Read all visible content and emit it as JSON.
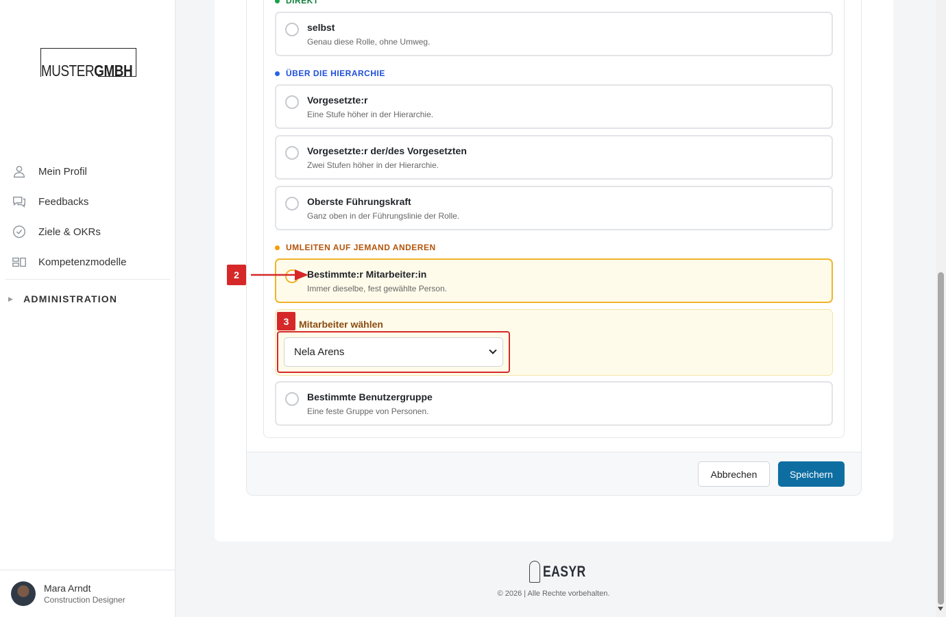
{
  "brand": {
    "logo_light": "MUSTER",
    "logo_bold": "GMBH"
  },
  "sidebar": {
    "items": [
      {
        "label": "Mein Profil",
        "icon": "user-icon"
      },
      {
        "label": "Feedbacks",
        "icon": "chat-icon"
      },
      {
        "label": "Ziele & OKRs",
        "icon": "check-circle-icon"
      },
      {
        "label": "Kompetenzmodelle",
        "icon": "grid-icon"
      }
    ],
    "admin_label": "ADMINISTRATION",
    "user": {
      "name": "Mara Arndt",
      "role": "Construction Designer"
    }
  },
  "form": {
    "sections": {
      "direct": {
        "label": "DIREKT",
        "color": "#16a34a"
      },
      "hierarchy": {
        "label": "ÜBER DIE HIERARCHIE",
        "color": "#2563eb"
      },
      "redirect": {
        "label": "UMLEITEN AUF JEMAND ANDEREN",
        "color": "#f59e0b"
      }
    },
    "options": [
      {
        "title": "selbst",
        "desc": "Genau diese Rolle, ohne Umweg.",
        "selected": false
      },
      {
        "title": "Vorgesetzte:r",
        "desc": "Eine Stufe höher in der Hierarchie.",
        "selected": false
      },
      {
        "title": "Vorgesetzte:r der/des Vorgesetzten",
        "desc": "Zwei Stufen höher in der Hierarchie.",
        "selected": false
      },
      {
        "title": "Oberste Führungskraft",
        "desc": "Ganz oben in der Führungslinie der Rolle.",
        "selected": false
      },
      {
        "title": "Bestimmte:r Mitarbeiter:in",
        "desc": "Immer dieselbe, fest gewählte Person.",
        "selected": true
      },
      {
        "title": "Bestimmte Benutzergruppe",
        "desc": "Eine feste Gruppe von Personen.",
        "selected": false
      }
    ],
    "picker": {
      "label": "Mitarbeiter wählen",
      "value": "Nela Arens"
    },
    "buttons": {
      "cancel": "Abbrechen",
      "save": "Speichern"
    }
  },
  "annotations": {
    "step2": "2",
    "step3": "3"
  },
  "footer": {
    "brand": "EASYR",
    "copyright": "© 2026 | Alle Rechte vorbehalten."
  }
}
